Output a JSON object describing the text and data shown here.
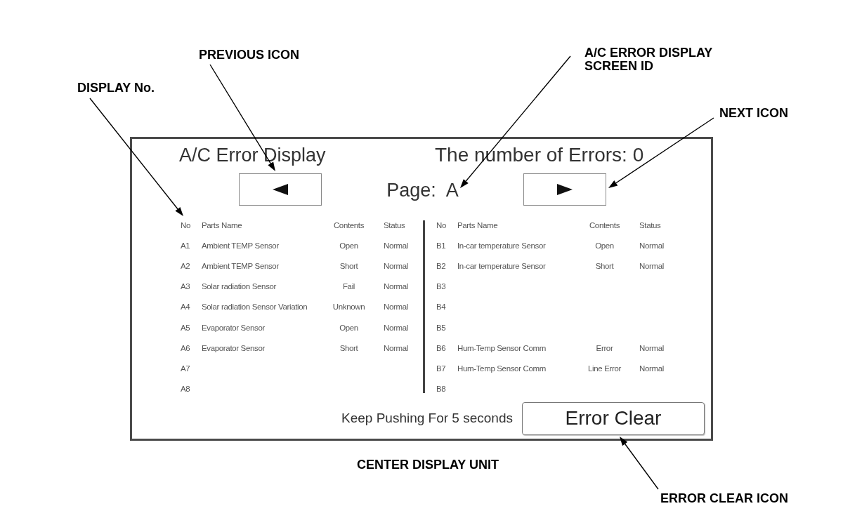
{
  "callouts": [
    {
      "label": "PREVIOUS ICON",
      "arrow": true
    },
    {
      "label": "A/C ERROR DISPLAY\nSCREEN ID",
      "arrow": true
    },
    {
      "label": "DISPLAY No.",
      "arrow": true
    },
    {
      "label": "NEXT ICON",
      "arrow": true
    },
    {
      "label": "CENTER DISPLAY UNIT",
      "arrow": false
    },
    {
      "label": "ERROR CLEAR ICON",
      "arrow": true
    }
  ],
  "screen": {
    "title": "A/C Error Display",
    "error_count": "The number of Errors: 0",
    "page": {
      "label": "Page:",
      "screen_id": "A"
    },
    "tables": [
      {
        "columns": [
          "No",
          "Parts Name",
          "Contents",
          "Status"
        ],
        "rows": [
          {
            "no": "A1",
            "parts_name": "Ambient TEMP Sensor",
            "contents": "Open",
            "status": "Normal"
          },
          {
            "no": "A2",
            "parts_name": "Ambient TEMP Sensor",
            "contents": "Short",
            "status": "Normal"
          },
          {
            "no": "A3",
            "parts_name": "Solar radiation Sensor",
            "contents": "Fail",
            "status": "Normal"
          },
          {
            "no": "A4",
            "parts_name": "Solar radiation Sensor Variation",
            "contents": "Unknown",
            "status": "Normal"
          },
          {
            "no": "A5",
            "parts_name": "Evaporator Sensor",
            "contents": "Open",
            "status": "Normal"
          },
          {
            "no": "A6",
            "parts_name": "Evaporator Sensor",
            "contents": "Short",
            "status": "Normal"
          },
          {
            "no": "A7"
          },
          {
            "no": "A8"
          }
        ]
      },
      {
        "columns": [
          "No",
          "Parts Name",
          "Contents",
          "Status"
        ],
        "rows": [
          {
            "no": "B1",
            "parts_name": "In-car temperature Sensor",
            "contents": "Open",
            "status": "Normal"
          },
          {
            "no": "B2",
            "parts_name": "In-car temperature Sensor",
            "contents": "Short",
            "status": "Normal"
          },
          {
            "no": "B3"
          },
          {
            "no": "B4"
          },
          {
            "no": "B5"
          },
          {
            "no": "B6",
            "parts_name": "Hum-Temp Sensor Comm",
            "contents": "Error",
            "status": "Normal"
          },
          {
            "no": "B7",
            "parts_name": "Hum-Temp Sensor Comm",
            "contents": "Line Error",
            "status": "Normal"
          },
          {
            "no": "B8"
          }
        ]
      }
    ],
    "hint": "Keep Pushing For 5 seconds",
    "error_clear_button": "Error Clear"
  }
}
